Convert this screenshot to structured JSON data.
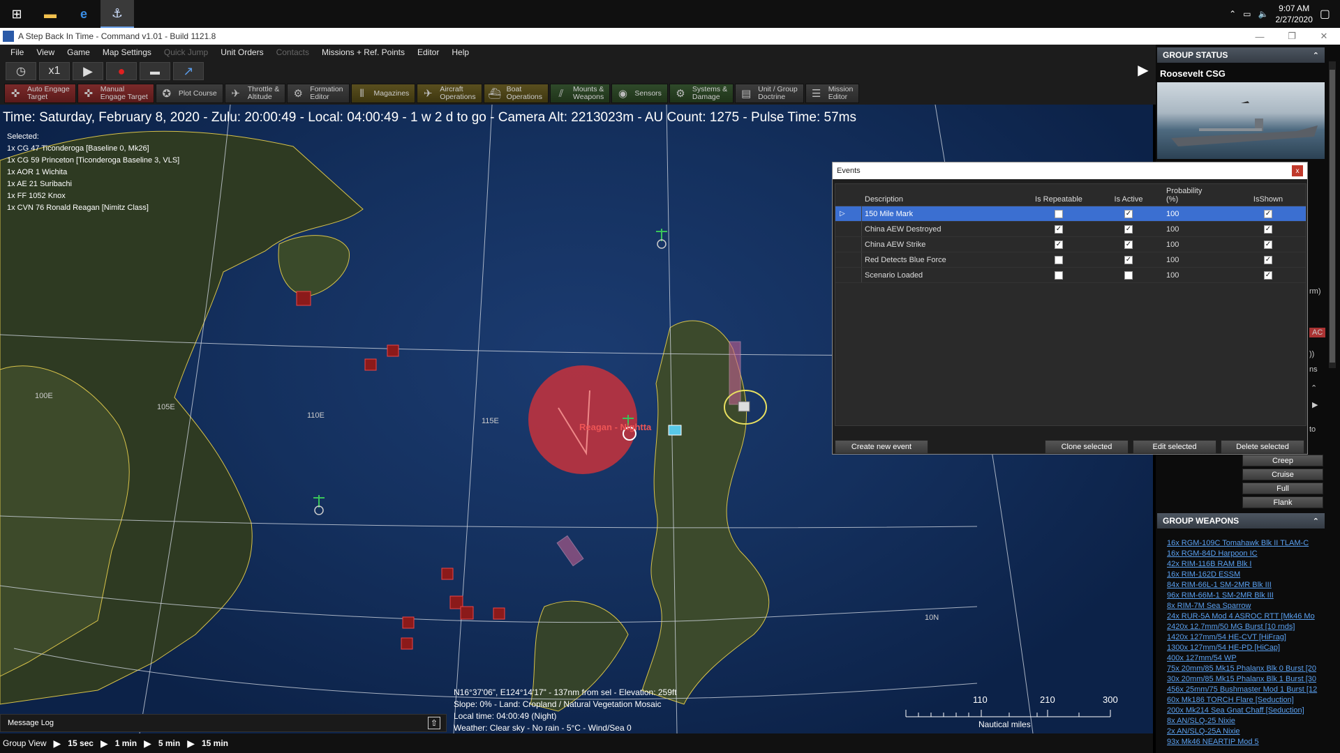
{
  "taskbar": {
    "time": "9:07 AM",
    "date": "2/27/2020"
  },
  "window": {
    "title": "A Step Back In Time - Command v1.01 - Build 1121.8"
  },
  "menu": {
    "items": [
      "File",
      "View",
      "Game",
      "Map Settings",
      "Quick Jump",
      "Unit Orders",
      "Contacts",
      "Missions + Ref. Points",
      "Editor",
      "Help"
    ]
  },
  "timecontrol": {
    "speed": "x1"
  },
  "toolbar": {
    "auto_engage": "Auto Engage\nTarget",
    "manual_engage": "Manual\nEngage Target",
    "plot_course": "Plot Course",
    "throttle": "Throttle &\nAltitude",
    "formation": "Formation\nEditor",
    "magazines": "Magazines",
    "aircraft": "Aircraft\nOperations",
    "boat": "Boat\nOperations",
    "mounts": "Mounts &\nWeapons",
    "sensors": "Sensors",
    "systems": "Systems &\nDamage",
    "doctrine": "Unit / Group\nDoctrine",
    "mission": "Mission\nEditor"
  },
  "map": {
    "status_line": "Time: Saturday, February 8, 2020 - Zulu: 20:00:49 - Local: 04:00:49 - 1 w 2 d to go -  Camera Alt: 2213023m  - AU Count: 1275 - Pulse Time: 57ms",
    "selected_label": "Selected:",
    "selected": [
      "1x CG 47 Ticonderoga [Baseline 0, Mk26]",
      "1x CG 59 Princeton [Ticonderoga Baseline 3, VLS]",
      "1x AOR 1 Wichita",
      "1x AE 21 Suribachi",
      "1x FF 1052 Knox",
      "1x CVN 76 Ronald Reagan [Nimitz Class]"
    ],
    "grid_labels": {
      "l100": "100E",
      "l105": "105E",
      "l110": "110E",
      "l115": "115E",
      "l10n": "10N"
    },
    "unit_label": "Reagan - Nightta",
    "coord_info": [
      "N16°37'06\", E124°14'17\" - 137nm from sel - Elevation: 259ft",
      "Slope: 0%  - Land: Cropland / Natural Vegetation Mosaic",
      "Local time: 04:00:49 (Night)",
      "Weather: Clear sky - No rain - 5°C - Wind/Sea 0"
    ],
    "scale_ticks": [
      "110",
      "210",
      "300"
    ],
    "scale_unit": "Nautical miles"
  },
  "message_log": "Message Log",
  "group_view": {
    "label": "Group View",
    "steps": [
      "15 sec",
      "1 min",
      "5 min",
      "15 min"
    ]
  },
  "group_status": {
    "header": "GROUP STATUS",
    "name": "Roosevelt CSG",
    "speeds": [
      "Creep",
      "Cruise",
      "Full",
      "Flank"
    ],
    "snippets": {
      "rm": "rm)",
      "ac": "AC",
      "paren": "))",
      "ns": "ns",
      "to": "to"
    }
  },
  "group_weapons": {
    "header": "GROUP WEAPONS",
    "items": [
      "16x RGM-109C Tomahawk Blk II TLAM-C",
      "16x RGM-84D Harpoon IC",
      "42x RIM-116B RAM Blk I",
      "16x RIM-162D ESSM",
      "84x RIM-66L-1 SM-2MR Blk III",
      "96x RIM-66M-1 SM-2MR Blk III",
      "8x RIM-7M Sea Sparrow",
      "24x RUR-5A Mod 4 ASROC RTT [Mk46 Mo",
      "2420x 12.7mm/50 MG Burst [10 rnds]",
      "1420x 127mm/54 HE-CVT [HiFrag]",
      "1300x 127mm/54 HE-PD [HiCap]",
      "400x 127mm/54 WP",
      "75x 20mm/85 Mk15 Phalanx Blk 0 Burst [20",
      "30x 20mm/85 Mk15 Phalanx Blk 1 Burst [30",
      "456x 25mm/75 Bushmaster Mod 1 Burst [12",
      "60x Mk186 TORCH Flare [Seduction]",
      "200x Mk214 Sea Gnat Chaff [Seduction]",
      "8x AN/SLQ-25 Nixie",
      "2x AN/SLQ-25A Nixie",
      "93x Mk46 NEARTIP Mod 5"
    ]
  },
  "events_dialog": {
    "title": "Events",
    "close": "x",
    "columns": {
      "description": "Description",
      "repeatable": "Is Repeatable",
      "active": "Is Active",
      "probability": "Probability\n(%)",
      "shown": "IsShown"
    },
    "rows": [
      {
        "description": "150 Mile Mark",
        "repeatable": false,
        "active": true,
        "probability": "100",
        "shown": true
      },
      {
        "description": "China AEW Destroyed",
        "repeatable": true,
        "active": true,
        "probability": "100",
        "shown": true
      },
      {
        "description": "China AEW Strike",
        "repeatable": true,
        "active": true,
        "probability": "100",
        "shown": true
      },
      {
        "description": "Red Detects Blue Force",
        "repeatable": false,
        "active": true,
        "probability": "100",
        "shown": true
      },
      {
        "description": "Scenario Loaded",
        "repeatable": false,
        "active": false,
        "probability": "100",
        "shown": true
      }
    ],
    "buttons": {
      "create": "Create new event",
      "clone": "Clone selected",
      "edit": "Edit selected",
      "delete": "Delete selected"
    }
  }
}
